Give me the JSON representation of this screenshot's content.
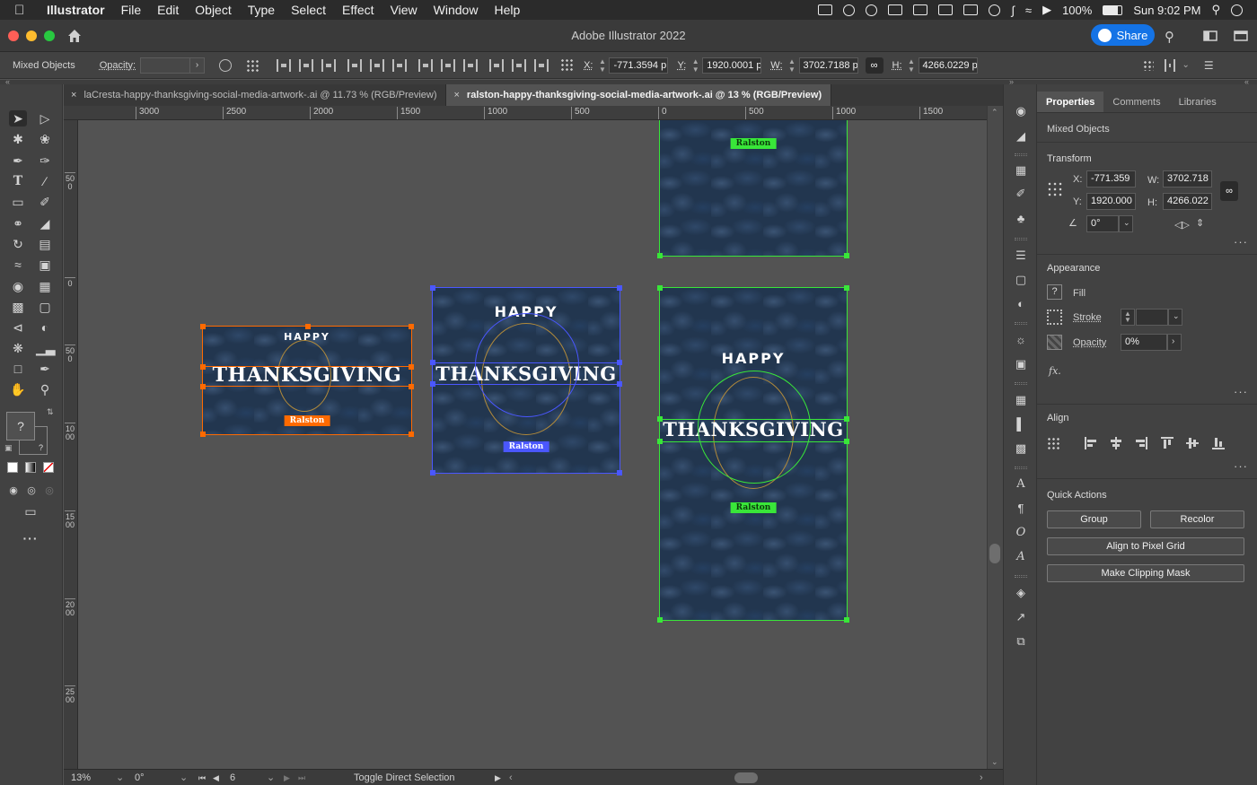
{
  "menubar": {
    "app_name": "Illustrator",
    "menus": [
      "File",
      "Edit",
      "Object",
      "Type",
      "Select",
      "Effect",
      "View",
      "Window",
      "Help"
    ],
    "battery": "100%",
    "clock": "Sun 9:02 PM"
  },
  "window": {
    "title": "Adobe Illustrator 2022",
    "share_label": "Share"
  },
  "control_bar": {
    "selection_label": "Mixed Objects",
    "opacity_label": "Opacity:",
    "x_label": "X:",
    "x_value": "-771.3594 p",
    "y_label": "Y:",
    "y_value": "1920.0001 p",
    "w_label": "W:",
    "w_value": "3702.7188 p",
    "h_label": "H:",
    "h_value": "4266.0229 p"
  },
  "tabs": [
    {
      "label": "laCresta-happy-thanksgiving-social-media-artwork-.ai @ 11.73 % (RGB/Preview)",
      "active": false
    },
    {
      "label": "ralston-happy-thanksgiving-social-media-artwork-.ai @ 13 % (RGB/Preview)",
      "active": true
    }
  ],
  "ruler_h": [
    "3000",
    "2500",
    "2000",
    "1500",
    "1000",
    "500",
    "0",
    "500",
    "1000",
    "1500"
  ],
  "ruler_v": [
    "500",
    "0",
    "500",
    "1000",
    "1500",
    "2000",
    "2500"
  ],
  "artwork": {
    "happy": "HAPPY",
    "thanksgiving": "THANKSGIVING",
    "brand": "Ralston"
  },
  "colors": {
    "sel_orange": "#ff6a00",
    "sel_blue": "#4a57ff",
    "sel_green": "#39e639",
    "accent_blue": "#1473e6"
  },
  "tools": {
    "unknown_fill": "?"
  },
  "status_bar": {
    "zoom": "13%",
    "rotation": "0°",
    "artboard_num": "6",
    "status_text": "Toggle Direct Selection"
  },
  "properties": {
    "tabs": [
      "Properties",
      "Comments",
      "Libraries"
    ],
    "selection_type": "Mixed Objects",
    "transform_title": "Transform",
    "x_label": "X:",
    "x_value": "-771.359",
    "y_label": "Y:",
    "y_value": "1920.000",
    "w_label": "W:",
    "w_value": "3702.718",
    "h_label": "H:",
    "h_value": "4266.022",
    "angle_value": "0°",
    "appearance_title": "Appearance",
    "fill_label": "Fill",
    "fill_unknown": "?",
    "stroke_label": "Stroke",
    "opacity_label": "Opacity",
    "opacity_value": "0%",
    "fx_label": "fx.",
    "align_title": "Align",
    "quick_actions_title": "Quick Actions",
    "group_button": "Group",
    "recolor_button": "Recolor",
    "pixel_grid_button": "Align to Pixel Grid",
    "clipping_mask_button": "Make Clipping Mask"
  }
}
